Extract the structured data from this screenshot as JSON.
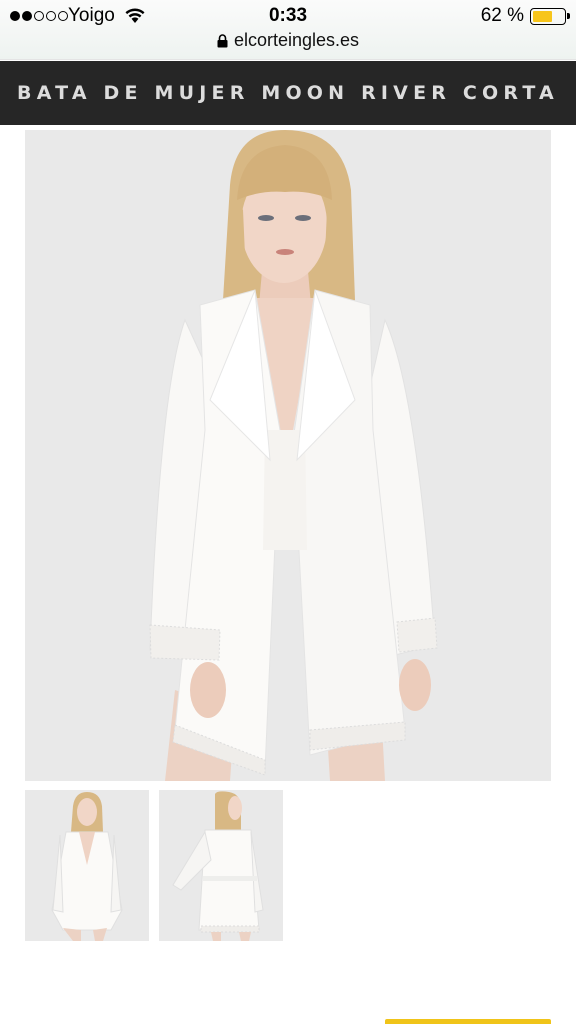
{
  "status_bar": {
    "carrier": "Yoigo",
    "time": "0:33",
    "battery_percent": "62 %",
    "battery_level": 0.62,
    "signal_bars_filled": 2,
    "signal_bars_total": 5,
    "url": "elcorteingles.es"
  },
  "page": {
    "title": "BATA DE MUJER MOON RIVER CORTA"
  },
  "gallery": {
    "main_image_icon": "product-photo-front",
    "thumbnails": [
      {
        "icon": "product-photo-front"
      },
      {
        "icon": "product-photo-back"
      }
    ]
  },
  "colors": {
    "title_bar_bg": "#262626",
    "image_bg": "#e9e9e9",
    "battery": "#f7c51b"
  }
}
